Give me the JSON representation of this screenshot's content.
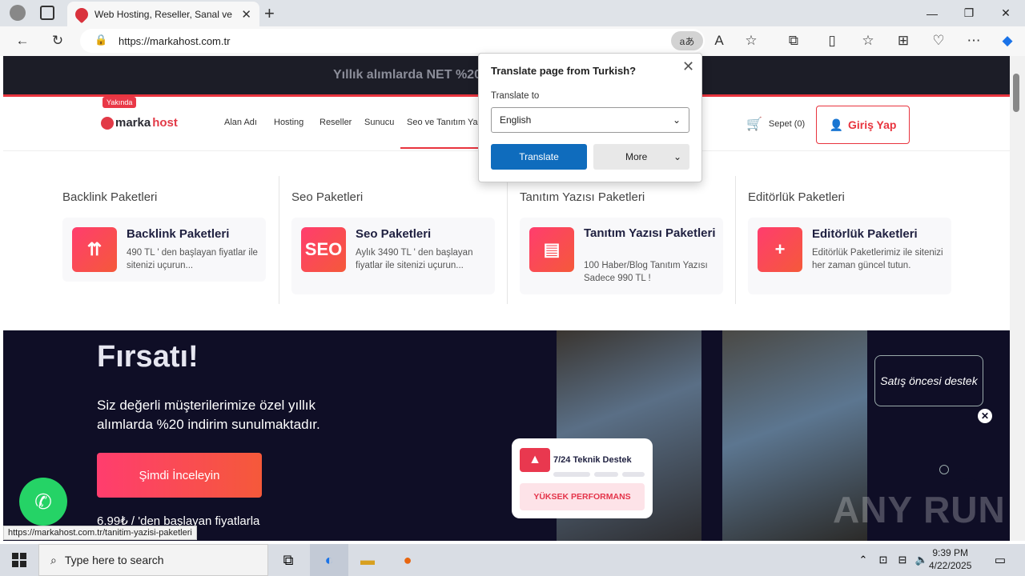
{
  "browser": {
    "tab_title": "Web Hosting, Reseller, Sanal ve F",
    "url": "https://markahost.com.tr",
    "translate_icon": "aあ",
    "new_tab": "+"
  },
  "promo": {
    "text": "Yıllık alımlarda NET %20 i"
  },
  "header": {
    "badge": "Yakında",
    "logo_brand": "marka",
    "logo_host": "host",
    "menu": [
      "Alan Adı",
      "Hosting",
      "Reseller",
      "Sunucu",
      "Seo ve Tanıtım Ya"
    ],
    "cart": "Sepet (0)",
    "login": "Giriş Yap"
  },
  "mega": {
    "columns": [
      {
        "heading": "Backlink Paketleri",
        "title": "Backlink Paketleri",
        "desc": "490 TL ' den başlayan fiyatlar ile sitenizi uçurun..."
      },
      {
        "heading": "Seo Paketleri",
        "title": "Seo Paketleri",
        "desc": "Aylık 3490 TL ' den başlayan fiyatlar ile sitenizi uçurun..."
      },
      {
        "heading": "Tanıtım Yazısı Paketleri",
        "title": "Tanıtım Yazısı Paketleri",
        "desc": "100 Haber/Blog Tanıtım Yazısı Sadece 990 TL !"
      },
      {
        "heading": "Editörlük Paketleri",
        "title": "Editörlük Paketleri",
        "desc": "Editörlük Paketlerimiz ile sitenizi her zaman güncel tutun."
      }
    ]
  },
  "hero": {
    "title": "Fırsatı!",
    "text": "Siz değerli müşterilerimize özel yıllık alımlarda %20 indirim sunulmaktadır.",
    "button": "Şimdi İnceleyin",
    "price": "6.99₺ / 'den başlayan fiyatlarla",
    "support_title": "7/24 Teknik Destek",
    "performance": "YÜKSEK PERFORMANS"
  },
  "chat": {
    "label": "Satış öncesi destek",
    "close": "✕"
  },
  "status_url": "https://markahost.com.tr/tanitim-yazisi-paketleri",
  "watermark": "ANY RUN",
  "translate_popup": {
    "title": "Translate page from Turkish?",
    "label": "Translate to",
    "language": "English",
    "translate_btn": "Translate",
    "more_btn": "More"
  },
  "taskbar": {
    "search_placeholder": "Type here to search",
    "time": "9:39 PM",
    "date": "4/22/2025"
  },
  "colors": {
    "accent": "#e8343e",
    "hero_bg": "#0f0e26",
    "translate_blue": "#0f6cbd"
  }
}
